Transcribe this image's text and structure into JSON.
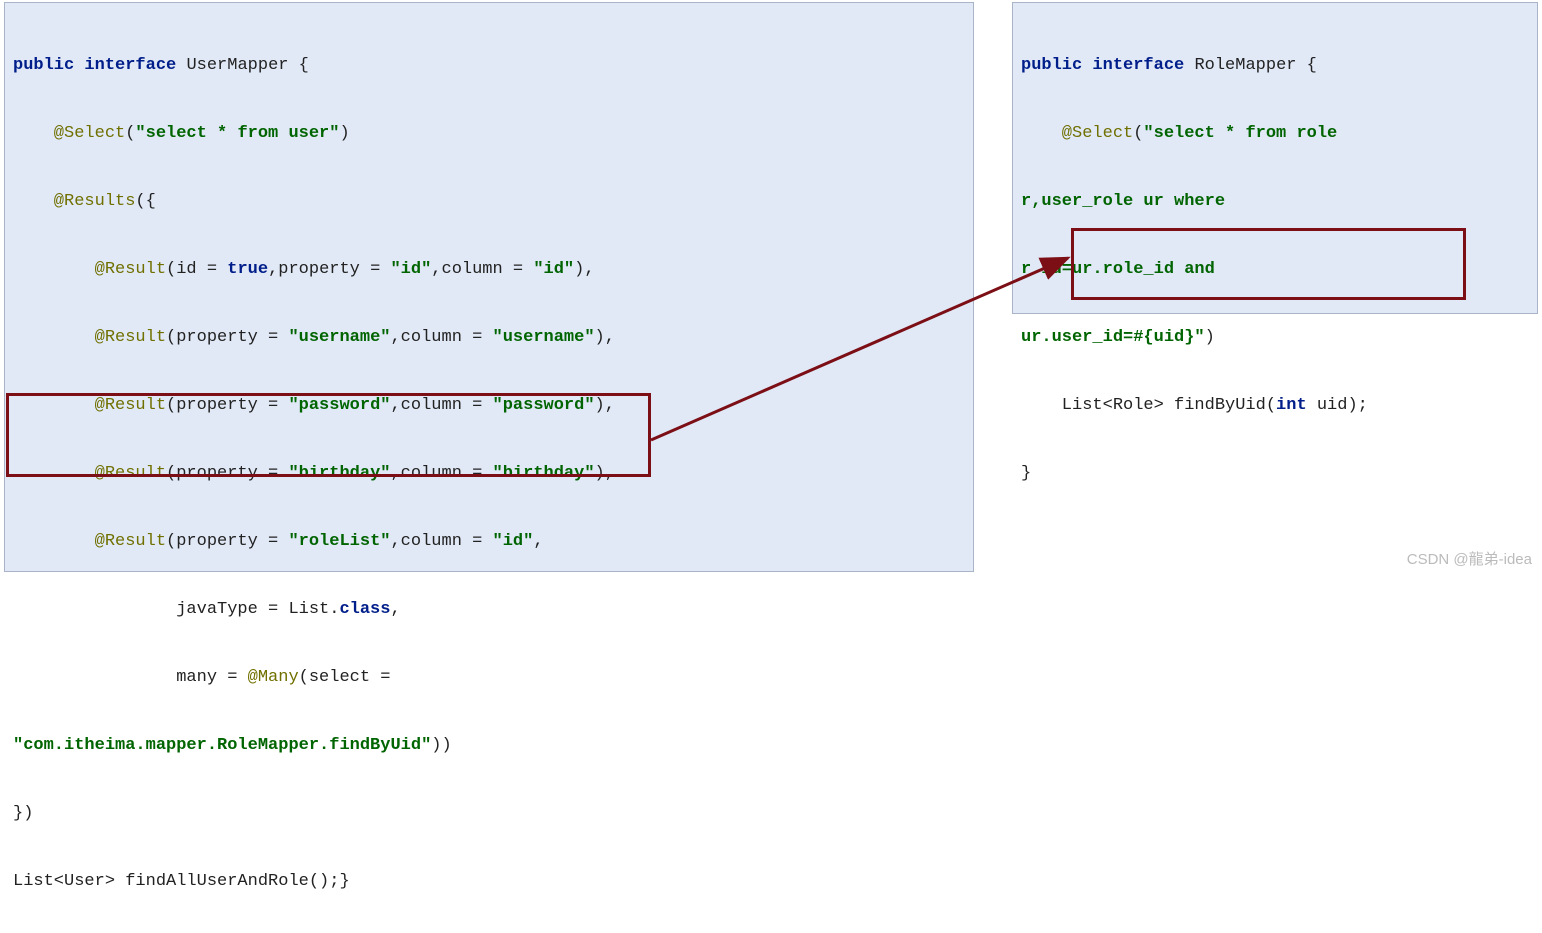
{
  "left": {
    "l1a": "public",
    "l1b": "interface",
    "l1c": " UserMapper {",
    "l2a": "    @Select",
    "l2b": "(",
    "l2c": "\"select * from user\"",
    "l2d": ")",
    "l3a": "    @Results",
    "l3b": "({",
    "l4a": "        @Result",
    "l4b": "(id = ",
    "l4c": "true",
    "l4d": ",property = ",
    "l4e": "\"id\"",
    "l4f": ",column = ",
    "l4g": "\"id\"",
    "l4h": "),",
    "l5a": "        @Result",
    "l5b": "(property = ",
    "l5c": "\"username\"",
    "l5d": ",column = ",
    "l5e": "\"username\"",
    "l5f": "),",
    "l6a": "        @Result",
    "l6b": "(property = ",
    "l6c": "\"password\"",
    "l6d": ",column = ",
    "l6e": "\"password\"",
    "l6f": "),",
    "l7a": "        @Result",
    "l7b": "(property = ",
    "l7c": "\"birthday\"",
    "l7d": ",column = ",
    "l7e": "\"birthday\"",
    "l7f": "),",
    "l8a": "        @Result",
    "l8b": "(property = ",
    "l8c": "\"roleList\"",
    "l8d": ",column = ",
    "l8e": "\"id\"",
    "l8f": ",",
    "l9a": "                javaType = List.",
    "l9b": "class",
    "l9c": ",",
    "l10a": "                many = ",
    "l10b": "@Many",
    "l10c": "(select = ",
    "l11a": "\"com.itheima.mapper.RoleMapper.findByUid\"",
    "l11b": "))",
    "l12": "})",
    "l13": "List<User> findAllUserAndRole();}"
  },
  "right": {
    "l1a": "public",
    "l1b": "interface",
    "l1c": " RoleMapper {",
    "l2a": "    @Select",
    "l2b": "(",
    "l2c": "\"select * from role ",
    "l3": "r,user_role ur where ",
    "l4": "r.id=ur.role_id and ",
    "l5a": "ur.user_id=#{uid}\"",
    "l5b": ")",
    "l6a": "    List<Role> findByUid(",
    "l6b": "int",
    "l6c": " uid);",
    "l7": "}"
  },
  "watermark": "CSDN @龍弟-idea"
}
